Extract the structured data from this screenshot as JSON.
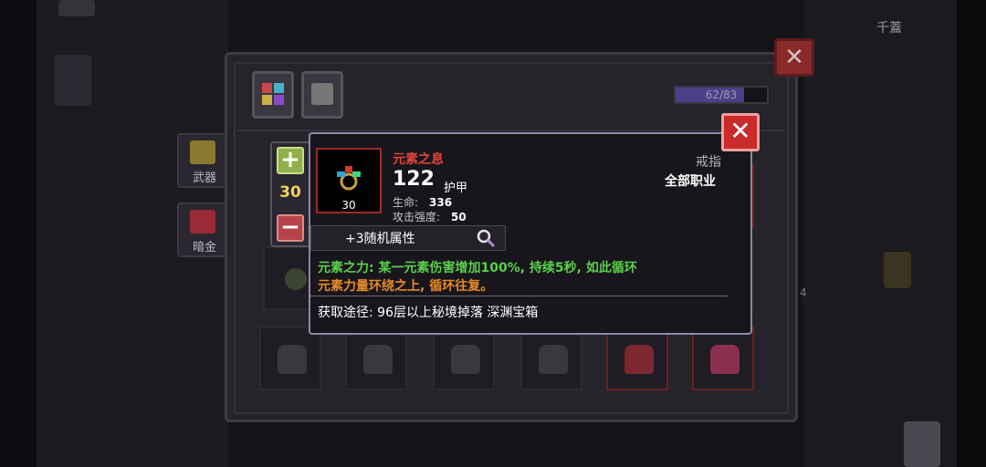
{
  "corner_text": "千蓋",
  "sidebar": {
    "weapon_tab_label": "武器",
    "secret_tab_label": "暗金"
  },
  "inventory": {
    "capacity_text": "62/83",
    "capacity_fraction": 0.747
  },
  "stepper": {
    "value": "30",
    "plus_label": "+",
    "minus_label": "−"
  },
  "item": {
    "name": "元素之息",
    "level": "30",
    "armor_value": "122",
    "armor_label": "护甲",
    "stats": [
      {
        "label": "生命:",
        "value": "336"
      },
      {
        "label": "攻击强度:",
        "value": "50"
      }
    ],
    "type": "戒指",
    "class_restriction": "全部职业",
    "random_affix": "+3随机属性",
    "effect_line1": "元素之力: 某一元素伤害增加100%, 持续5秒, 如此循环",
    "effect_line2": "元素力量环绕之上, 循环往复。",
    "source": "获取途径: 96层以上秘境掉落 深渊宝箱"
  },
  "side_number": "4",
  "colors": {
    "item_name": "#e0433e",
    "effect_green": "#5ad04a",
    "effect_orange": "#e68a2a",
    "close_button": "#c92a2a",
    "stepper_value": "#f0d25c"
  }
}
